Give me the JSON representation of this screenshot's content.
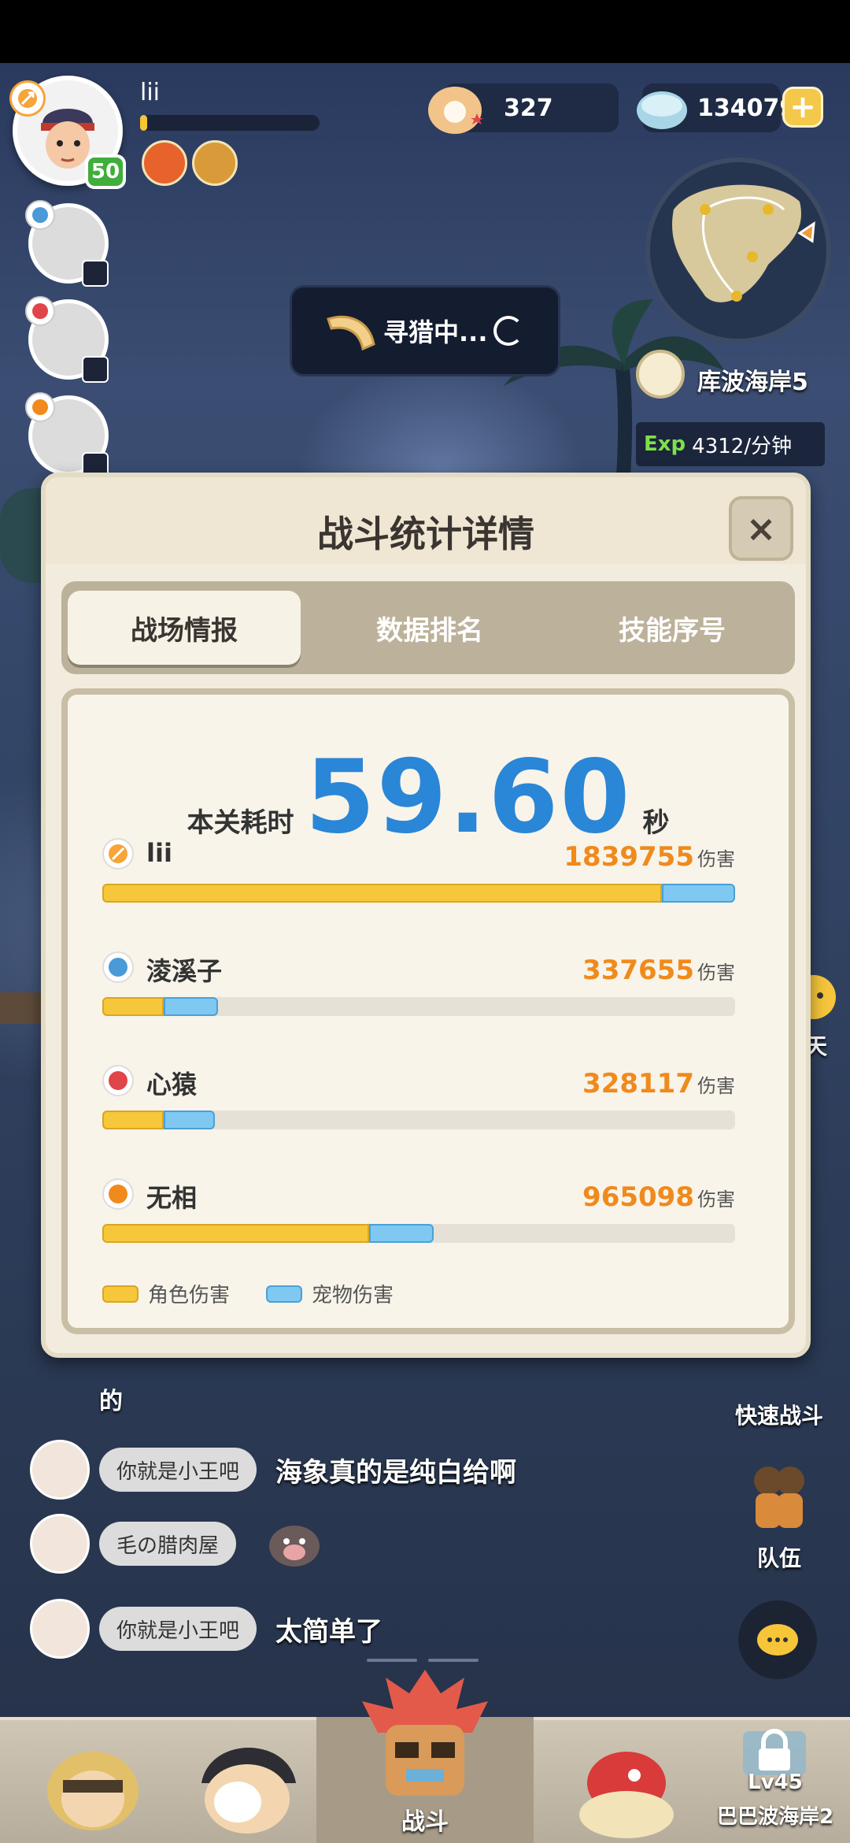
{
  "player": {
    "name": "lii",
    "level": "50",
    "exp_progress": 0.04
  },
  "currency": {
    "pearls": "327",
    "shells": "134079"
  },
  "hunting": {
    "label": "寻猎中..."
  },
  "map": {
    "zone_name": "库波海岸5",
    "exp_label": "Exp",
    "exp_rate": "4312/分钟"
  },
  "dialog": {
    "title": "战斗统计详情",
    "close_label": "×",
    "tabs": [
      {
        "label": "战场情报",
        "active": true
      },
      {
        "label": "数据排名",
        "active": false
      },
      {
        "label": "技能序号",
        "active": false
      }
    ],
    "time_label": "本关耗时",
    "time_value": "59.60",
    "time_unit": "秒",
    "damage_unit": "伤害",
    "legend": {
      "character": "角色伤害",
      "pet": "宠物伤害"
    },
    "rows": [
      {
        "name": "lii",
        "damage": "1839755",
        "char_frac": 0.884,
        "pet_frac": 0.116,
        "total_frac": 1.0,
        "icon": "bow-class-icon"
      },
      {
        "name": "淩溪子",
        "damage": "337655",
        "char_frac": 0.097,
        "pet_frac": 0.086,
        "total_frac": 0.183,
        "icon": "water-class-icon"
      },
      {
        "name": "心猿",
        "damage": "328117",
        "char_frac": 0.097,
        "pet_frac": 0.081,
        "total_frac": 0.178,
        "icon": "fire-class-icon"
      },
      {
        "name": "无相",
        "damage": "965098",
        "char_frac": 0.422,
        "pet_frac": 0.102,
        "total_frac": 0.524,
        "icon": "claw-class-icon"
      }
    ]
  },
  "chat": {
    "fragment": "的",
    "messages": [
      {
        "name": "你就是小王吧",
        "text": "海象真的是纯白给啊"
      },
      {
        "name": "毛の腊肉屋",
        "text": ""
      },
      {
        "name": "你就是小王吧",
        "text": "太简单了"
      }
    ],
    "chat_button": "聊天"
  },
  "side": {
    "quick_battle": "快速战斗",
    "team": "队伍"
  },
  "nav": {
    "battle": "战斗",
    "locked_level": "Lv45",
    "locked_zone": "巴巴波海岸2"
  },
  "colors": {
    "time_blue": "#2a86d6",
    "damage_orange": "#f08a1c",
    "char_bar": "#f6c73a",
    "pet_bar": "#7ec8f2",
    "level_green": "#3fae3a"
  }
}
